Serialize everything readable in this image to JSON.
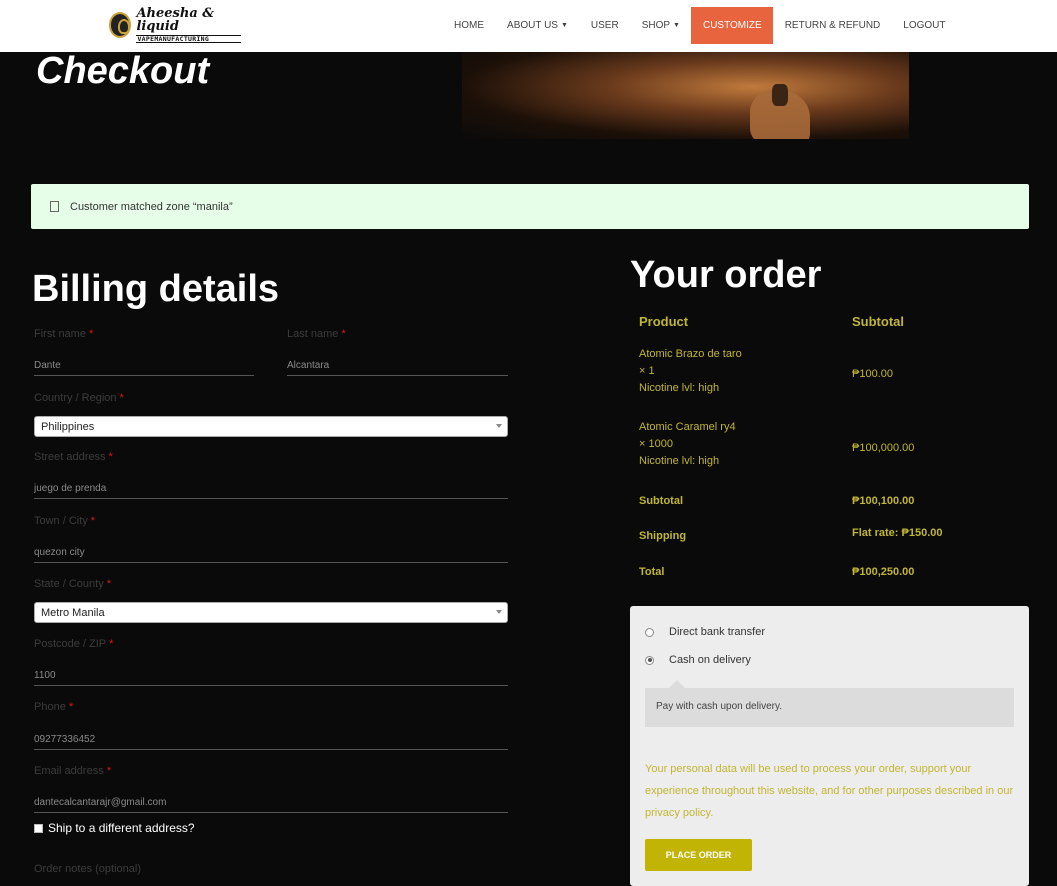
{
  "brand": {
    "name": "Aheesha & liquid",
    "tagline": "VAPEMANUFACTURING"
  },
  "nav": {
    "items": [
      {
        "label": "HOME",
        "caret": false,
        "active": false
      },
      {
        "label": "ABOUT US",
        "caret": true,
        "active": false
      },
      {
        "label": "USER",
        "caret": false,
        "active": false
      },
      {
        "label": "SHOP",
        "caret": true,
        "active": false
      },
      {
        "label": "CUSTOMIZE",
        "caret": false,
        "active": true
      },
      {
        "label": "RETURN & REFUND",
        "caret": false,
        "active": false
      },
      {
        "label": "LOGOUT",
        "caret": false,
        "active": false
      }
    ]
  },
  "page": {
    "title": "Checkout"
  },
  "notice": {
    "text": "Customer matched zone “manila”"
  },
  "billing": {
    "title": "Billing details",
    "required_mark": "*",
    "first_name": {
      "label": "First name",
      "value": "Dante"
    },
    "last_name": {
      "label": "Last name",
      "value": "Alcantara"
    },
    "country": {
      "label": "Country / Region",
      "value": "Philippines"
    },
    "street": {
      "label": "Street address",
      "value": "juego de prenda"
    },
    "town": {
      "label": "Town / City",
      "value": "quezon city"
    },
    "state": {
      "label": "State / County",
      "value": "Metro Manila"
    },
    "postcode": {
      "label": "Postcode / ZIP",
      "value": "1100"
    },
    "phone": {
      "label": "Phone",
      "value": "09277336452"
    },
    "email": {
      "label": "Email address",
      "value": "dantecalcantarajr@gmail.com"
    },
    "ship_different": {
      "label": "Ship to a different address?",
      "checked": false
    },
    "order_notes": {
      "label": "Order notes (optional)"
    }
  },
  "order": {
    "title": "Your order",
    "col_product": "Product",
    "col_subtotal": "Subtotal",
    "items": [
      {
        "name": "Atomic Brazo de taro",
        "qty": "× 1",
        "meta": "Nicotine lvl: high",
        "subtotal": "₱100.00"
      },
      {
        "name": "Atomic Caramel ry4",
        "qty": "× 1000",
        "meta": "Nicotine lvl: high",
        "subtotal": "₱100,000.00"
      }
    ],
    "subtotal_label": "Subtotal",
    "subtotal_value": "₱100,100.00",
    "shipping_label": "Shipping",
    "shipping_value": "Flat rate: ₱150.00",
    "total_label": "Total",
    "total_value": "₱100,250.00"
  },
  "payment": {
    "options": [
      {
        "label": "Direct bank transfer",
        "selected": false
      },
      {
        "label": "Cash on delivery",
        "selected": true
      }
    ],
    "cod_description": "Pay with cash upon delivery.",
    "privacy_text": "Your personal data will be used to process your order, support your experience throughout this website, and for other purposes described in our privacy policy.",
    "place_order_label": "PLACE ORDER"
  },
  "colors": {
    "accent": "#e8643f",
    "gold": "#c1b633",
    "button": "#c1b405",
    "notice_bg": "#e6fde8"
  }
}
